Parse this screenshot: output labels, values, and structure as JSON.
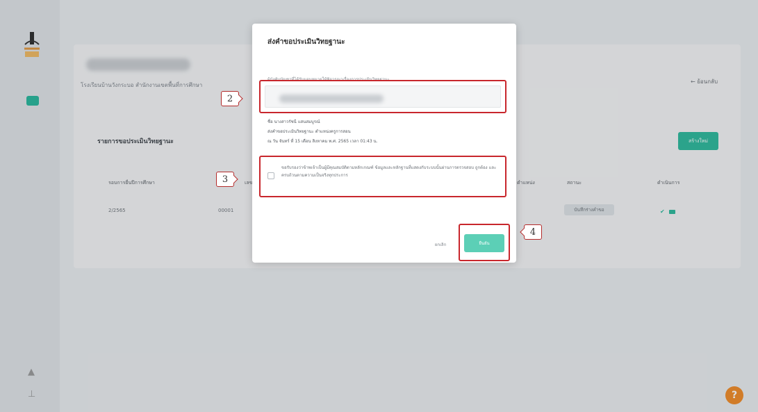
{
  "sidebar": {
    "logo_icon": "school-logo-icon",
    "nav_icon": "credential-card-icon",
    "bottom_icons": [
      "bell-icon",
      "user-icon"
    ]
  },
  "page": {
    "subtitle": "โรงเรียนบ้านวังกระบอ สำนักงานเขตพื้นที่การศึกษา",
    "back_label": "← ย้อนกลับ"
  },
  "list": {
    "title": "รายการขอประเมินวิทยฐานะ",
    "add_button": "สร้างใหม่",
    "headers": [
      "รอบการยื่นปีการศึกษา",
      "เลขที่",
      "ตำแหน่ง",
      "สถานะ",
      "ดำเนินการ"
    ],
    "rows": [
      {
        "year": "2/2565",
        "number": "00001",
        "status": "บันทึกร่างคำขอ"
      }
    ]
  },
  "modal": {
    "title": "ส่งคำขอประเมินวิทยฐานะ",
    "field_label": "ผู้บังคับบัญชาที่ได้รับมอบหมายให้พิจารณาเรื่องการประเมินวิทยฐานะ",
    "info_lines": [
      "ชื่อ นางสาวรัชนี แสนสมบูรณ์",
      "ส่งคำขอประเมินวิทยฐานะ ตำแหน่งครูการสอน",
      "ณ วัน จันทร์ ที่ 15 เดือน สิงหาคม พ.ศ. 2565 เวลา 01:43 น."
    ],
    "consent_text": "ขอรับรองว่าข้าพเจ้าเป็นผู้มีคุณสมบัติตามหลักเกณฑ์ ข้อมูลและหลักฐานที่แสดงกับระบบนั้นผ่านการตรวจสอบ ถูกต้อง และครบถ้วนตามความเป็นจริงทุกประการ",
    "cancel_label": "ยกเลิก",
    "confirm_label": "ยืนยัน"
  },
  "callouts": [
    "2",
    "3",
    "4"
  ],
  "colors": {
    "accent": "#2ab89a",
    "highlight_border": "#c8262c",
    "help_button": "#f08a24"
  },
  "help": {
    "icon": "question-icon",
    "glyph": "?"
  }
}
